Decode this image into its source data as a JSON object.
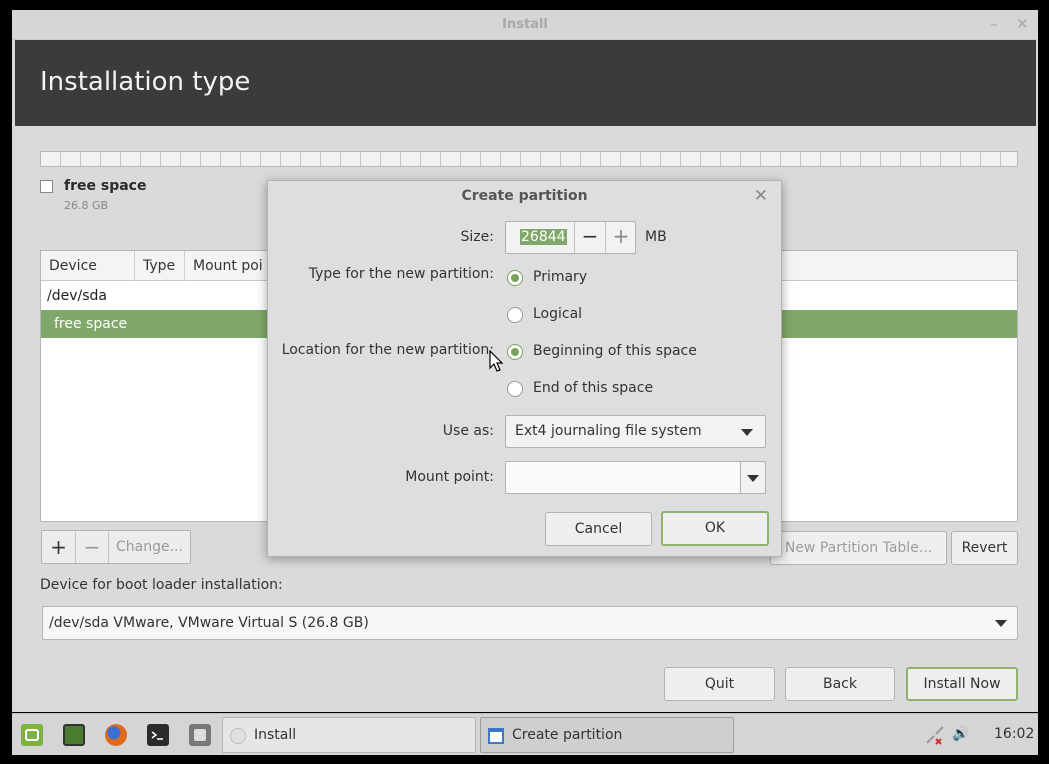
{
  "window": {
    "title": "Install",
    "minimize_glyph": "–",
    "close_glyph": "✕"
  },
  "header": {
    "title": "Installation type"
  },
  "legend": {
    "name": "free space",
    "size": "26.8 GB"
  },
  "table": {
    "columns": [
      "Device",
      "Type",
      "Mount poi"
    ],
    "rows": [
      {
        "label": "/dev/sda",
        "selected": false
      },
      {
        "label": "free space",
        "selected": true
      }
    ]
  },
  "table_buttons": {
    "add": "+",
    "remove": "−",
    "change": "Change..."
  },
  "partition_buttons": {
    "new_table": "New Partition Table...",
    "revert": "Revert"
  },
  "boot_loader": {
    "label": "Device for boot loader installation:",
    "value": "/dev/sda VMware, VMware Virtual S (26.8 GB)"
  },
  "footer_buttons": {
    "quit": "Quit",
    "back": "Back",
    "install_now": "Install Now"
  },
  "dialog": {
    "title": "Create partition",
    "close_glyph": "✕",
    "size_label": "Size:",
    "size_value": "26844",
    "size_unit": "MB",
    "minus": "−",
    "plus": "+",
    "type_label": "Type for the new partition:",
    "type_options": [
      "Primary",
      "Logical"
    ],
    "type_selected": "Primary",
    "location_label": "Location for the new partition:",
    "location_options": [
      "Beginning of this space",
      "End of this space"
    ],
    "location_selected": "Beginning of this space",
    "use_as_label": "Use as:",
    "use_as_value": "Ext4 journaling file system",
    "mount_label": "Mount point:",
    "mount_value": "",
    "cancel": "Cancel",
    "ok": "OK"
  },
  "taskbar": {
    "tasks": [
      {
        "label": "Install",
        "active": false
      },
      {
        "label": "Create partition",
        "active": true
      }
    ],
    "clock": "16:02",
    "volume_glyph": "🔊"
  },
  "colors": {
    "accent": "#80a86a",
    "header_bg": "#3b3b3b"
  }
}
